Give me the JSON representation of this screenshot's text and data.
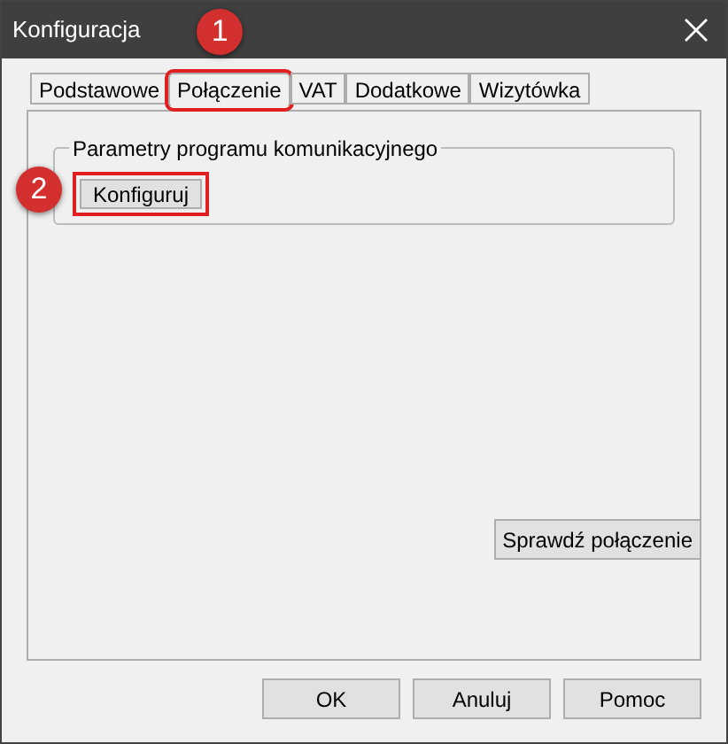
{
  "window": {
    "title": "Konfiguracja"
  },
  "tabs": [
    {
      "label": "Podstawowe",
      "selected": false
    },
    {
      "label": "Połączenie",
      "selected": true,
      "highlighted": true,
      "marker": "1"
    },
    {
      "label": "VAT",
      "selected": false
    },
    {
      "label": "Dodatkowe",
      "selected": false
    },
    {
      "label": "Wizytówka",
      "selected": false
    }
  ],
  "group": {
    "title": "Parametry programu komunikacyjnego",
    "button": {
      "label": "Konfiguruj",
      "highlighted": true,
      "marker": "2"
    }
  },
  "check_button": "Sprawdź połączenie",
  "buttons": [
    "OK",
    "Anuluj",
    "Pomoc"
  ]
}
